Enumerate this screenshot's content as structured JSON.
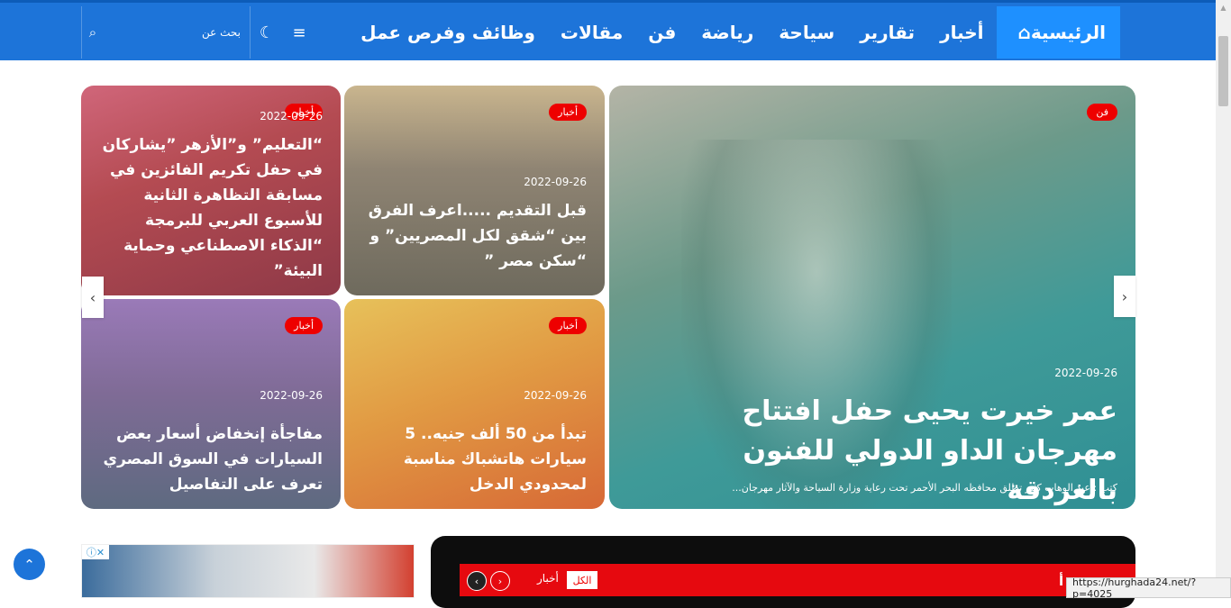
{
  "nav": {
    "items": [
      {
        "label": "الرئيسية",
        "icon": "home-icon",
        "active": true
      },
      {
        "label": "أخبار"
      },
      {
        "label": "تقارير"
      },
      {
        "label": "سياحة"
      },
      {
        "label": "رياضة"
      },
      {
        "label": "فن"
      },
      {
        "label": "مقالات"
      },
      {
        "label": "وظائف وفرص عمل"
      }
    ],
    "search_placeholder": "بحث عن",
    "search_icon": "⌕",
    "menu_icon": "≡",
    "moon_icon": "☾",
    "home_glyph": "⌂"
  },
  "slider": {
    "main": {
      "badge": "فن",
      "date": "2022-09-26",
      "title": "عمر خيرت يحيى حفل افتتاح مهرجان الداو الدولي للفنون بالغردقة",
      "excerpt": "كتب : عبد الوهاب كثير  تطلق محافظه البحر الأحمر تحت رعاية وزارة السياحة والآثار مهرجان..."
    },
    "cards": [
      {
        "badge": "أخبار",
        "date": "2022-09-26",
        "title": "قبل التقديم .....اعرف الفرق بين “شقق لكل المصريين” و “سكن مصر ”"
      },
      {
        "badge": "أخبار",
        "date": "2022-09-26",
        "title": "“التعليم” و”الأزهر ”يشاركان في حفل تكريم الفائزين في مسابقة التظاهرة الثانية للأسبوع العربي للبرمجة “الذكاء الاصطناعي وحماية البيئة”"
      },
      {
        "badge": "أخبار",
        "date": "2022-09-26",
        "title": "تبدأ من 50 ألف جنيه.. 5 سيارات هاتشباك مناسبة لمحدودي الدخل"
      },
      {
        "badge": "أخبار",
        "date": "2022-09-26",
        "title": "مفاجأة إنخفاض أسعار بعض السيارات في السوق المصري تعرف على التفاصيل"
      }
    ],
    "prev_icon": "‹",
    "next_icon": "›"
  },
  "widget": {
    "title": "أ",
    "tab_all": "الكل",
    "tab_news": "أخبار",
    "btn_prev": "‹",
    "btn_next": "›"
  },
  "ad": {
    "info_icon": "ⓘ✕"
  },
  "back_to_top": "⌃",
  "status_url": "https://hurghada24.net/?p=4025",
  "colors": {
    "nav_bg": "#1d74d9",
    "nav_active": "#1e90ff",
    "badge": "#e00000",
    "widget_red": "#e6090f"
  }
}
